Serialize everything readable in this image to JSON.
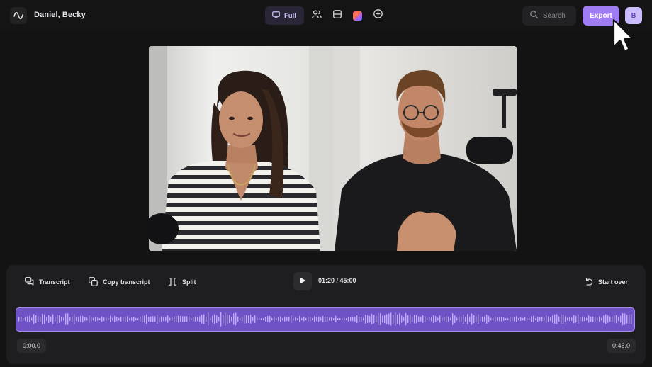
{
  "header": {
    "title": "Daniel, Becky",
    "view_label": "Full",
    "search_placeholder": "Search",
    "export_label": "Export",
    "avatar_initial": "B",
    "icons": [
      "waveform-logo-icon",
      "monitor-icon",
      "people-icon",
      "layout-rows-icon",
      "color-gradient-icon",
      "add-circle-icon",
      "search-icon"
    ]
  },
  "video": {
    "left_speaker": "woman-in-striped-shirt",
    "right_speaker": "man-with-glasses"
  },
  "toolbar": {
    "transcript_label": "Transcript",
    "copy_transcript_label": "Copy transcript",
    "split_label": "Split",
    "time_readout": "01:20 / 45:00",
    "start_over_label": "Start over"
  },
  "timeline": {
    "start_time": "0:00.0",
    "end_time": "0:45.0"
  },
  "colors": {
    "accent": "#a07cf2",
    "waveform_bg": "#6e52c6",
    "waveform_border": "#a68cf2",
    "panel_bg": "#1e1e20",
    "app_bg": "#131313"
  }
}
